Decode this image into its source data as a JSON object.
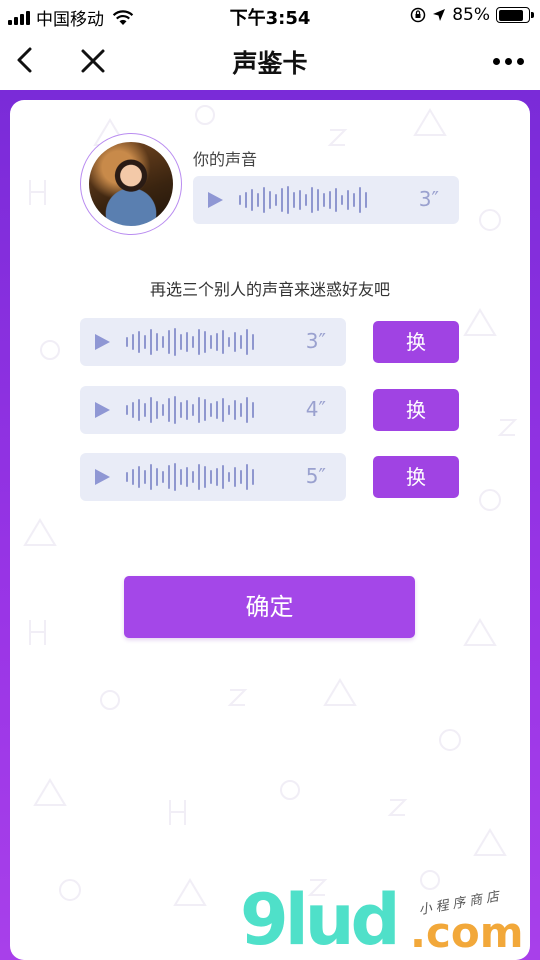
{
  "status_bar": {
    "carrier": "中国移动",
    "time": "下午3:54",
    "battery": "85%",
    "battery_level": 0.85
  },
  "nav": {
    "title": "声鉴卡",
    "icons": [
      "back-icon",
      "close-icon",
      "more-icon"
    ]
  },
  "profile": {
    "your_voice_label": "你的声音",
    "your_voice_duration": "3″"
  },
  "prompt": "再选三个别人的声音来迷惑好友吧",
  "options": [
    {
      "duration": "3″",
      "swap_label": "换"
    },
    {
      "duration": "4″",
      "swap_label": "换"
    },
    {
      "duration": "5″",
      "swap_label": "换"
    }
  ],
  "confirm_label": "确定",
  "watermark": {
    "brand": "9lud",
    "domain": ".com",
    "tagline": "小程序商店"
  },
  "colors": {
    "accent": "#a447e8",
    "background": "#8a30df",
    "voice_bar": "#e9ecf7",
    "wave": "#8f97cf"
  }
}
